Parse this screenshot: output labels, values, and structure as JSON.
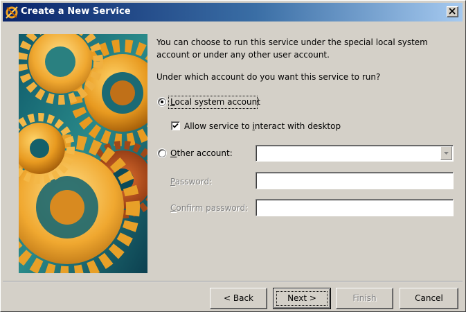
{
  "window": {
    "title": "Create a New Service",
    "title_icon": "service-wizard-icon",
    "close_icon": "close-icon"
  },
  "banner": {
    "image": "gears-illustration"
  },
  "content": {
    "intro_line1": "You can choose to run this service under the special local system",
    "intro_line2": "account or under any other user account.",
    "question": "Under which account do you want this service to run?",
    "local_system": {
      "label": "Local system account",
      "accesskey": "L",
      "selected": true
    },
    "interact_desktop": {
      "label": "Allow service to interact with desktop",
      "accesskey": "i",
      "checked": true
    },
    "other_account": {
      "label": "Other account:",
      "accesskey": "O",
      "selected": false,
      "value": ""
    },
    "password": {
      "label": "Password:",
      "accesskey": "P",
      "value": ""
    },
    "confirm_password": {
      "label": "Confirm password:",
      "accesskey": "C",
      "value": ""
    }
  },
  "buttons": {
    "back": "< Back",
    "next": "Next >",
    "finish": "Finish",
    "cancel": "Cancel"
  },
  "colors": {
    "titlebar_start": "#0a246a",
    "titlebar_end": "#a6caf0",
    "dialog_bg": "#d4d0c8"
  }
}
